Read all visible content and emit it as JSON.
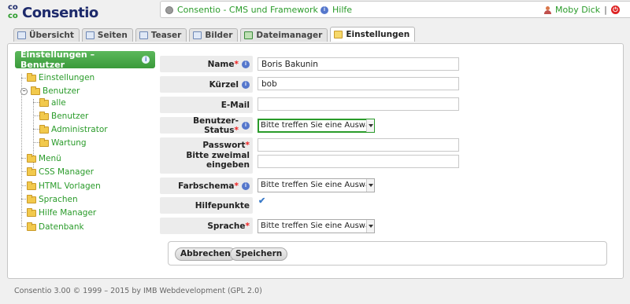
{
  "app": {
    "logo_prefix_top": "co",
    "logo_prefix_bottom": "co",
    "logo_word": "Consentio"
  },
  "topbar": {
    "title": "Consentio - CMS und Framework",
    "help": "Hilfe",
    "user": "Moby Dick",
    "separator": "|"
  },
  "tabs": [
    {
      "label": "Übersicht"
    },
    {
      "label": "Seiten"
    },
    {
      "label": "Teaser"
    },
    {
      "label": "Bilder"
    },
    {
      "label": "Dateimanager"
    },
    {
      "label": "Einstellungen"
    }
  ],
  "sidebar": {
    "title": "Einstellungen – Benutzer",
    "items": [
      {
        "label": "Einstellungen"
      },
      {
        "label": "Benutzer"
      },
      {
        "label": "alle"
      },
      {
        "label": "Benutzer"
      },
      {
        "label": "Administrator"
      },
      {
        "label": "Wartung"
      },
      {
        "label": "Menü"
      },
      {
        "label": "CSS Manager"
      },
      {
        "label": "HTML Vorlagen"
      },
      {
        "label": "Sprachen"
      },
      {
        "label": "Hilfe Manager"
      },
      {
        "label": "Datenbank"
      }
    ]
  },
  "form": {
    "name_label": "Name",
    "name_value": "Boris Bakunin",
    "kuerzel_label": "Kürzel",
    "kuerzel_value": "bob",
    "email_label": "E-Mail",
    "email_value": "",
    "status_label": "Benutzer-Status",
    "status_value": "Bitte treffen Sie eine Auswahl",
    "passwort_label": "Passwort",
    "passwort2_label": "Bitte zweimal eingeben",
    "farbschema_label": "Farbschema",
    "farbschema_value": "Bitte treffen Sie eine Auswahl",
    "hilfepunkte_label": "Hilfepunkte",
    "hilfepunkte_checked": true,
    "sprache_label": "Sprache",
    "sprache_value": "Bitte treffen Sie eine Auswahl",
    "required_mark": "*",
    "cancel_label": "Abbrechen",
    "save_label": "Speichern"
  },
  "footer": {
    "text": "Consentio 3.00 © 1999 – 2015 by IMB Webdevelopment (GPL 2.0)"
  }
}
